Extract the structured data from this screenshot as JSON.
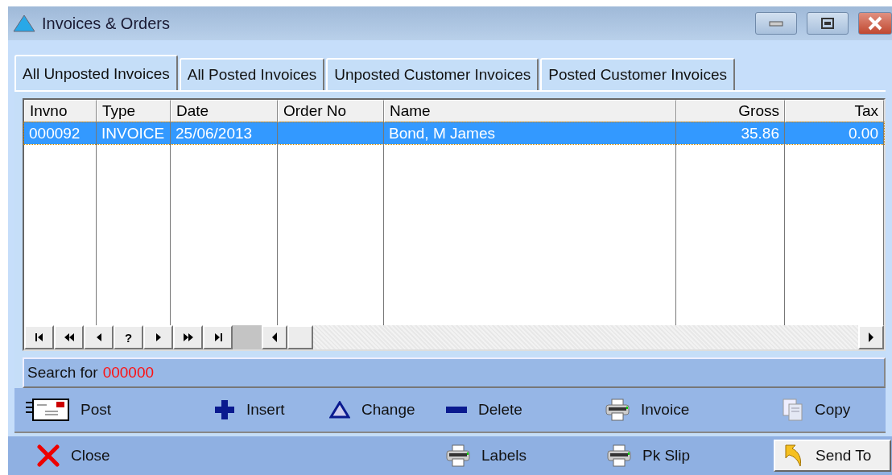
{
  "window": {
    "title": "Invoices & Orders"
  },
  "tabs": [
    {
      "label": "All Unposted Invoices",
      "selected": true
    },
    {
      "label": "All Posted Invoices",
      "selected": false
    },
    {
      "label": "Unposted Customer Invoices",
      "selected": false
    },
    {
      "label": "Posted Customer Invoices",
      "selected": false
    }
  ],
  "table": {
    "columns": [
      {
        "label": "Invno",
        "kind": "text"
      },
      {
        "label": "Type",
        "kind": "text"
      },
      {
        "label": "Date",
        "kind": "text"
      },
      {
        "label": "Order No",
        "kind": "text"
      },
      {
        "label": "Name",
        "kind": "text"
      },
      {
        "label": "Gross",
        "kind": "number"
      },
      {
        "label": "Tax",
        "kind": "number"
      }
    ],
    "rows": [
      {
        "selected": true,
        "cells": [
          "000092",
          "INVOICE",
          "25/06/2013",
          "",
          "Bond, M James",
          "35.86",
          "0.00"
        ]
      }
    ]
  },
  "navigator": [
    {
      "kind": "first"
    },
    {
      "kind": "prev-page"
    },
    {
      "kind": "prev"
    },
    {
      "kind": "help",
      "label": "?"
    },
    {
      "kind": "next"
    },
    {
      "kind": "next-page"
    },
    {
      "kind": "last"
    }
  ],
  "search": {
    "label": "Search for",
    "value": "000000"
  },
  "actions": [
    {
      "kind": "post",
      "label": "Post"
    },
    {
      "kind": "insert",
      "label": "Insert"
    },
    {
      "kind": "change",
      "label": "Change"
    },
    {
      "kind": "delete",
      "label": "Delete"
    },
    {
      "kind": "print",
      "label": "Invoice"
    },
    {
      "kind": "copy",
      "label": "Copy"
    }
  ],
  "footer_actions": [
    {
      "kind": "close",
      "label": "Close",
      "raised": false
    },
    {
      "kind": "print",
      "label": "Labels",
      "raised": false
    },
    {
      "kind": "print",
      "label": "Pk Slip",
      "raised": false
    },
    {
      "kind": "sendto",
      "label": "Send To",
      "raised": true
    }
  ]
}
